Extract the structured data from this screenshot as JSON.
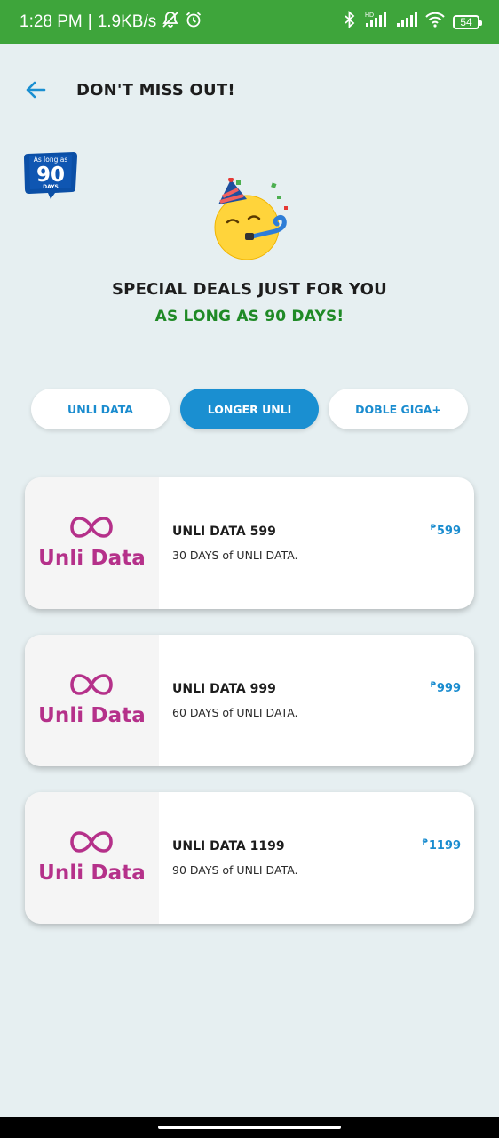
{
  "status_bar": {
    "time": "1:28 PM",
    "separator": "|",
    "speed": "1.9KB/s",
    "battery": "54",
    "icons": [
      "mute-notification-icon",
      "alarm-icon",
      "bluetooth-icon",
      "hd-signal-icon",
      "signal-icon",
      "wifi-icon",
      "battery-icon"
    ]
  },
  "header": {
    "back_icon": "arrow-left-icon",
    "title": "DON'T MISS OUT!"
  },
  "promo_badge": {
    "top_text": "As long as",
    "number": "90",
    "bottom_text": "DAYS"
  },
  "hero": {
    "emoji": "party-face-emoji",
    "headline": "SPECIAL DEALS JUST FOR YOU",
    "subheadline": "AS LONG AS 90 DAYS!"
  },
  "tabs": [
    {
      "label": "UNLI DATA",
      "active": false
    },
    {
      "label": "LONGER UNLI",
      "active": true
    },
    {
      "label": "DOBLE GIGA+",
      "active": false
    }
  ],
  "offers": [
    {
      "logo_text": "Unli Data",
      "name": "UNLI DATA 599",
      "description": "30 DAYS of UNLI DATA.",
      "currency": "₱",
      "price": "599"
    },
    {
      "logo_text": "Unli Data",
      "name": "UNLI DATA 999",
      "description": "60 DAYS of UNLI DATA.",
      "currency": "₱",
      "price": "999"
    },
    {
      "logo_text": "Unli Data",
      "name": "UNLI DATA 1199",
      "description": "90 DAYS of UNLI DATA.",
      "currency": "₱",
      "price": "1199"
    }
  ],
  "colors": {
    "status_bar": "#3ea53b",
    "background": "#e6eff1",
    "accent_blue": "#1a8fd1",
    "green_text": "#1f8a26",
    "logo_magenta": "#b5318a"
  }
}
